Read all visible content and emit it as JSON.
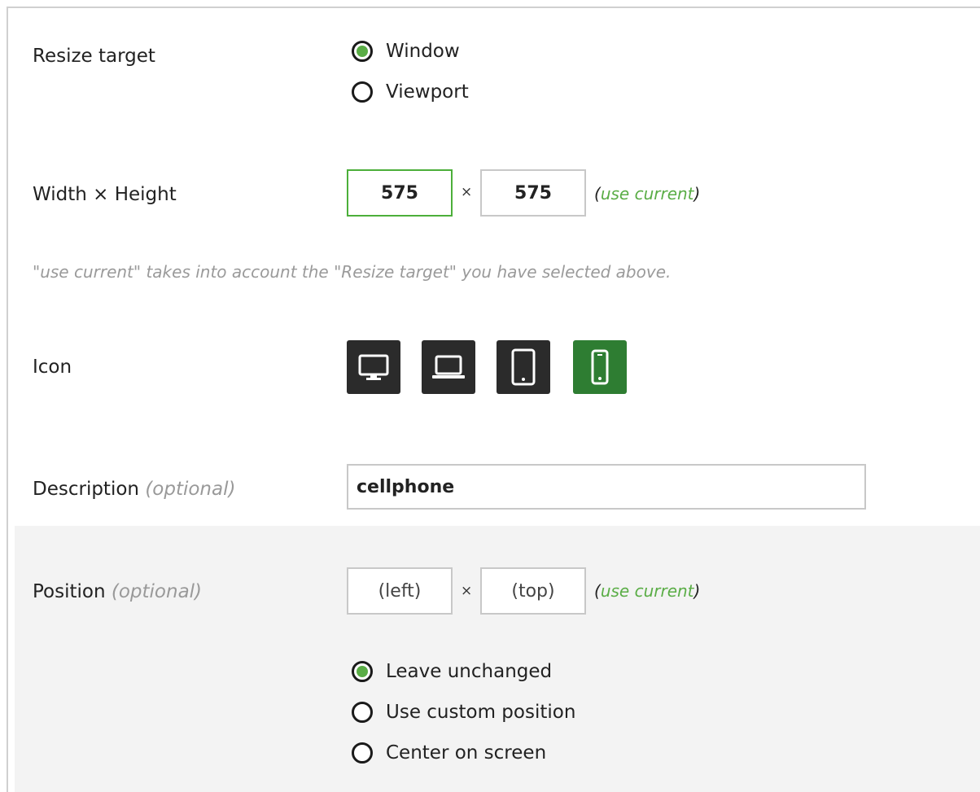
{
  "resize_target": {
    "label": "Resize target",
    "options": [
      "Window",
      "Viewport"
    ],
    "selected": "Window"
  },
  "dimensions": {
    "label": "Width × Height",
    "width": "575",
    "height": "575",
    "separator": "×",
    "use_current_open": "(",
    "use_current_link": "use current",
    "use_current_close": ")",
    "hint": "\"use current\" takes into account the \"Resize target\" you have selected above."
  },
  "icon": {
    "label": "Icon",
    "options": [
      "desktop-icon",
      "laptop-icon",
      "tablet-icon",
      "cellphone-icon"
    ],
    "selected": "cellphone-icon"
  },
  "description": {
    "label": "Description",
    "optional": "(optional)",
    "value": "cellphone"
  },
  "position": {
    "label": "Position",
    "optional": "(optional)",
    "left_placeholder": "(left)",
    "top_placeholder": "(top)",
    "separator": "×",
    "use_current_open": "(",
    "use_current_link": "use current",
    "use_current_close": ")",
    "options": [
      "Leave unchanged",
      "Use custom position",
      "Center on screen"
    ],
    "selected": "Leave unchanged"
  },
  "colors": {
    "accent": "#5aad46",
    "active_icon_bg": "#2e7d32",
    "icon_bg": "#2b2b2b",
    "section_bg": "#f3f3f3"
  }
}
